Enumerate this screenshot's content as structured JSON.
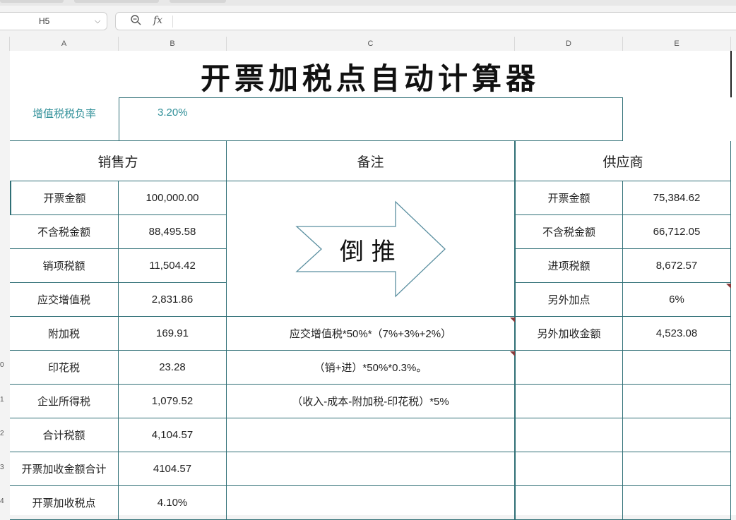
{
  "name_box": "H5",
  "formula_bar": {
    "zoom_icon": "zoom-icon",
    "fx_label": "fx",
    "value": ""
  },
  "columns": [
    "A",
    "B",
    "C",
    "D",
    "E"
  ],
  "row_numbers": [
    "0",
    "1",
    "2",
    "3",
    "4"
  ],
  "title": "开票加税点自动计算器",
  "rate_label": "增值税税负率",
  "rate_value": "3.20%",
  "headers": {
    "seller": "销售方",
    "note": "备注",
    "supplier": "供应商"
  },
  "seller_rows": [
    {
      "label": "开票金额",
      "value": "100,000.00"
    },
    {
      "label": "不含税金额",
      "value": "88,495.58"
    },
    {
      "label": "销项税额",
      "value": "11,504.42"
    },
    {
      "label": "应交增值税",
      "value": "2,831.86"
    },
    {
      "label": "附加税",
      "value": "169.91"
    },
    {
      "label": "印花税",
      "value": "23.28"
    },
    {
      "label": "企业所得税",
      "value": "1,079.52"
    },
    {
      "label": "合计税额",
      "value": "4,104.57"
    },
    {
      "label": "开票加收金额合计",
      "value": "4104.57"
    },
    {
      "label": "开票加收税点",
      "value": "4.10%"
    }
  ],
  "arrow_text": "倒 推",
  "notes": [
    "应交增值税*50%*（7%+3%+2%）",
    "（销+进）*50%*0.3%。",
    "（收入-成本-附加税-印花税）*5%"
  ],
  "supplier_rows": [
    {
      "label": "开票金额",
      "value": "75,384.62"
    },
    {
      "label": "不含税金额",
      "value": "66,712.05"
    },
    {
      "label": "进项税额",
      "value": "8,672.57"
    },
    {
      "label": "另外加点",
      "value": "6%"
    },
    {
      "label": "另外加收金额",
      "value": "4,523.08"
    }
  ],
  "colors": {
    "border": "#2f6f76",
    "accent": "#2f8f98",
    "comment_marker": "#8a3a3a"
  }
}
